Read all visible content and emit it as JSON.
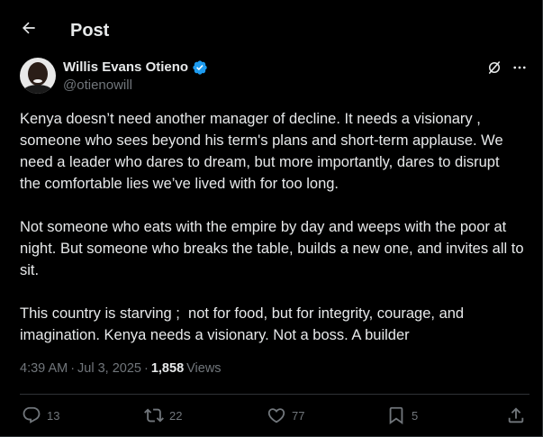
{
  "header": {
    "title": "Post"
  },
  "author": {
    "display_name": "Willis Evans Otieno",
    "handle": "@otienowill"
  },
  "post": {
    "paragraphs": [
      "Kenya doesn’t need another manager of decline. It needs a visionary , someone who sees beyond his term's plans and short-term applause. We need a leader who dares to dream, but more importantly, dares to disrupt the comfortable lies we’ve lived with for too long.",
      "Not someone who eats with the empire by day and weeps with the poor at night. But someone who breaks the table, builds a new one, and invites all to sit.",
      "This country is starving ;  not for food, but for integrity, courage, and imagination. Kenya needs a visionary. Not a boss. A builder"
    ],
    "time": "4:39 AM",
    "date": "Jul 3, 2025",
    "separator": "·",
    "views_count": "1,858",
    "views_label": "Views"
  },
  "actions": {
    "replies": "13",
    "reposts": "22",
    "likes": "77",
    "bookmarks": "5"
  },
  "colors": {
    "background": "#000000",
    "text_primary": "#e7e9ea",
    "text_secondary": "#71767b",
    "verified_badge": "#1d9bf0",
    "divider": "#2f3336"
  }
}
